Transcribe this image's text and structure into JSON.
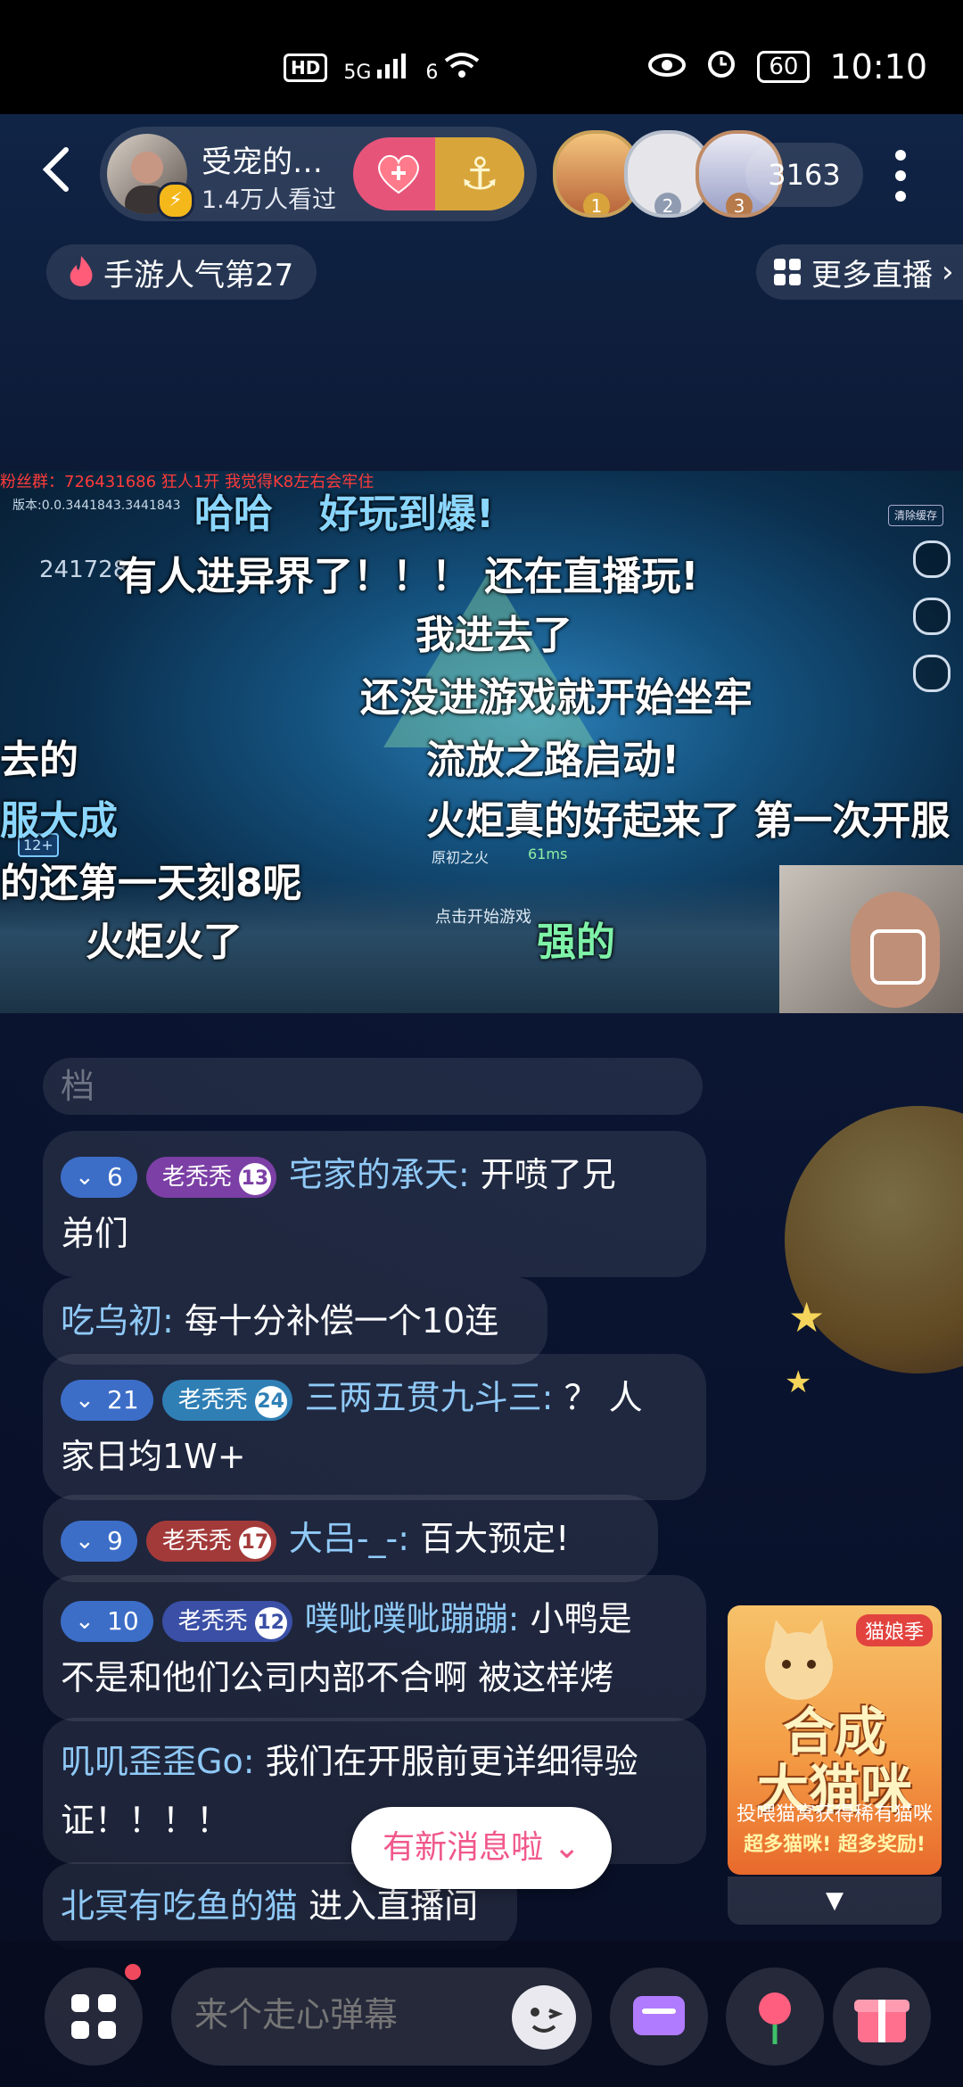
{
  "status_bar": {
    "network": "5G",
    "wifi_badge": "6",
    "battery": "60",
    "time": "10:10"
  },
  "header": {
    "anchor_name": "受宠的…",
    "viewers_label": "1.4万人看过",
    "top_viewers": [
      "1",
      "2",
      "3"
    ],
    "online_count": "3163",
    "popularity_tag": "手游人气第27",
    "more_live_label": "更多直播"
  },
  "video": {
    "fan_group": "粉丝群：726431686    狂人1开  我觉得K8左右会牢住",
    "version_text": "版本:0.0.3441843.3441843",
    "room_id": "241728",
    "clear_cache": "清除缓存",
    "game_hint": "点击开始游戏",
    "game_sub": "原初之火",
    "ping": "61ms",
    "age_rating": "12+",
    "danmaku": [
      {
        "text": "哈哈",
        "color": "#8ad6ff"
      },
      {
        "text": "好玩到爆!",
        "color": "#8ad6ff"
      },
      {
        "text": "有人进异界了！！！ 还在直播玩!",
        "color": "#ffffff"
      },
      {
        "text": "我进去了",
        "color": "#ffffff"
      },
      {
        "text": "还没进游戏就开始坐牢",
        "color": "#ffffff"
      },
      {
        "text": "去的",
        "color": "#ffffff"
      },
      {
        "text": "流放之路启动!",
        "color": "#ffffff"
      },
      {
        "text": "服大成",
        "color": "#8ad6ff"
      },
      {
        "text": "火炬真的好起来了 第一次开服",
        "color": "#ffffff"
      },
      {
        "text": "的还第一天刻8呢",
        "color": "#ffffff"
      },
      {
        "text": "火炬火了",
        "color": "#ffffff"
      },
      {
        "text": "强的",
        "color": "#7ef2a8"
      }
    ]
  },
  "chat": {
    "faded_item": "档",
    "messages": [
      {
        "level": "6",
        "level_color": "#3c6ec8",
        "medal": "老秃秃",
        "medal_num": "13",
        "medal_color": "#7b3fa5",
        "user": "宅家的承天",
        "text": "开喷了兄",
        "text2": "弟们"
      },
      {
        "user": "吃乌初",
        "text": "每十分补偿一个10连"
      },
      {
        "level": "21",
        "level_color": "#3c6ec8",
        "medal": "老秃秃",
        "medal_num": "24",
        "medal_color": "#2f7fb5",
        "user": "三两五贯九斗三",
        "text": "？ 人",
        "text2": "家日均1W+"
      },
      {
        "level": "9",
        "level_color": "#3c6ec8",
        "medal": "老秃秃",
        "medal_num": "17",
        "medal_color": "#a33a3a",
        "user": "大吕-_-",
        "text": "百大预定!"
      },
      {
        "level": "10",
        "level_color": "#3c6ec8",
        "medal": "老秃秃",
        "medal_num": "12",
        "medal_color": "#3a4fa5",
        "user": "噗呲噗呲蹦蹦",
        "text": "小鸭是",
        "text2": "不是和他们公司内部不合啊 被这样烤"
      },
      {
        "user": "叽叽歪歪Go",
        "text": "我们在开服前更详细得验",
        "text2": "证！！！！"
      }
    ],
    "enter_user": "北冥有吃鱼的猫",
    "enter_text": "进入直播间",
    "new_msg_label": "有新消息啦"
  },
  "promo": {
    "tag": "猫娘季",
    "title_line1": "合成",
    "title_line2": "大猫咪",
    "sub1": "投喂猫窝获得稀有猫咪",
    "sub2": "超多猫咪! 超多奖励!"
  },
  "bottom": {
    "input_placeholder": "来个走心弹幕"
  },
  "colors": {
    "accent_pink": "#e7547a",
    "name_blue": "#8fc9f7",
    "gold": "#d8a53a"
  }
}
